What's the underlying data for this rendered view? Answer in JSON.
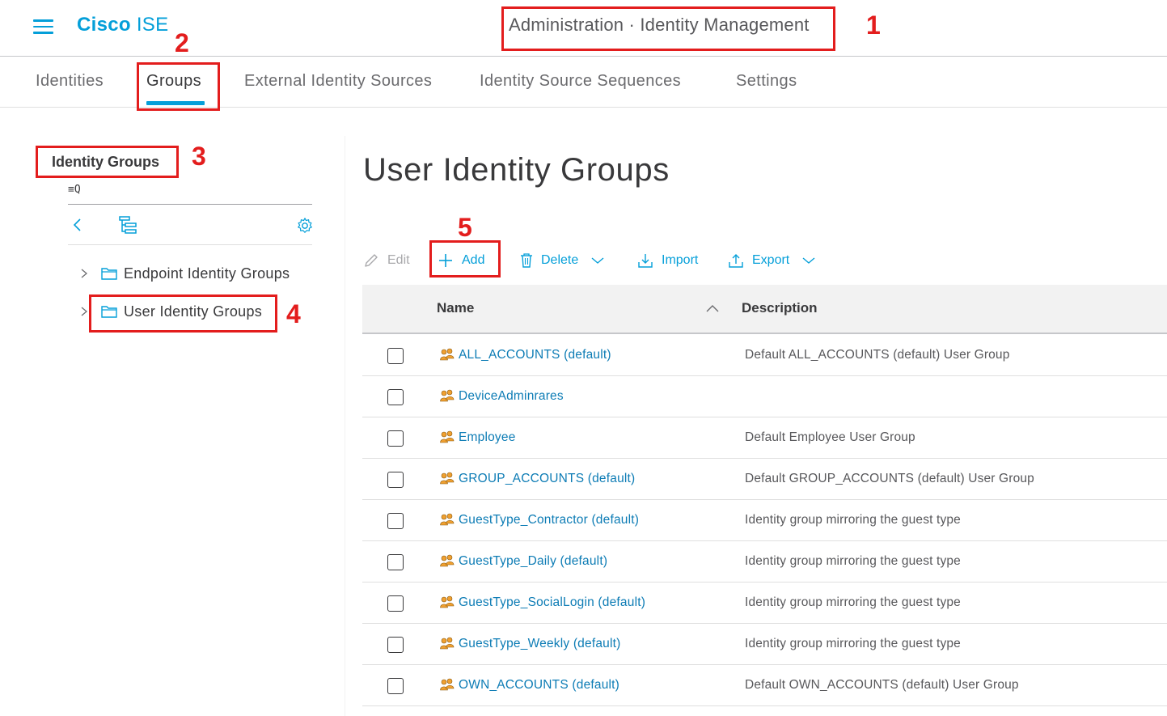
{
  "header": {
    "brand_bold": "Cisco",
    "brand_light": "ISE",
    "page_heading": "Administration · Identity Management"
  },
  "tabs": [
    {
      "label": "Identities",
      "active": false
    },
    {
      "label": "Groups",
      "active": true
    },
    {
      "label": "External Identity Sources",
      "active": false
    },
    {
      "label": "Identity Source Sequences",
      "active": false
    },
    {
      "label": "Settings",
      "active": false
    }
  ],
  "sidebar": {
    "title": "Identity Groups",
    "filter_glyph": "≡Q",
    "items": [
      {
        "label": "Endpoint Identity Groups"
      },
      {
        "label": "User Identity Groups"
      }
    ]
  },
  "main": {
    "title": "User Identity Groups",
    "toolbar": {
      "edit": "Edit",
      "add": "Add",
      "delete": "Delete",
      "import": "Import",
      "export": "Export"
    },
    "columns": {
      "name": "Name",
      "description": "Description"
    },
    "rows": [
      {
        "name": "ALL_ACCOUNTS (default)",
        "description": "Default ALL_ACCOUNTS (default) User Group"
      },
      {
        "name": "DeviceAdminrares",
        "description": ""
      },
      {
        "name": "Employee",
        "description": "Default Employee User Group"
      },
      {
        "name": "GROUP_ACCOUNTS (default)",
        "description": "Default GROUP_ACCOUNTS (default) User Group"
      },
      {
        "name": "GuestType_Contractor (default)",
        "description": "Identity group mirroring the guest type"
      },
      {
        "name": "GuestType_Daily (default)",
        "description": "Identity group mirroring the guest type"
      },
      {
        "name": "GuestType_SocialLogin (default)",
        "description": "Identity group mirroring the guest type"
      },
      {
        "name": "GuestType_Weekly (default)",
        "description": "Identity group mirroring the guest type"
      },
      {
        "name": "OWN_ACCOUNTS (default)",
        "description": "Default OWN_ACCOUNTS (default) User Group"
      }
    ]
  },
  "annotations": [
    "1",
    "2",
    "3",
    "4",
    "5"
  ],
  "colors": {
    "accent": "#049fd9",
    "link": "#0d7cb5",
    "annotation": "#e31d1d",
    "group_icon": "#f0a030"
  }
}
